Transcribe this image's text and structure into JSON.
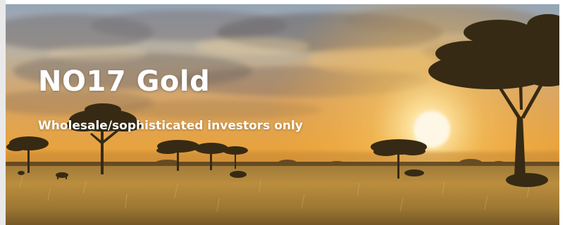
{
  "hero": {
    "title": "NO17 Gold",
    "subtitle": "Wholesale/sophisticated investors only",
    "image_description": "savanna-sunset-with-acacia-trees"
  },
  "colors": {
    "title_text": "#ffffff",
    "sky_top": "#8fa6c0",
    "sun": "#fff2c8",
    "grass": "#b48a3c",
    "tree_silhouette": "#2b2413"
  }
}
